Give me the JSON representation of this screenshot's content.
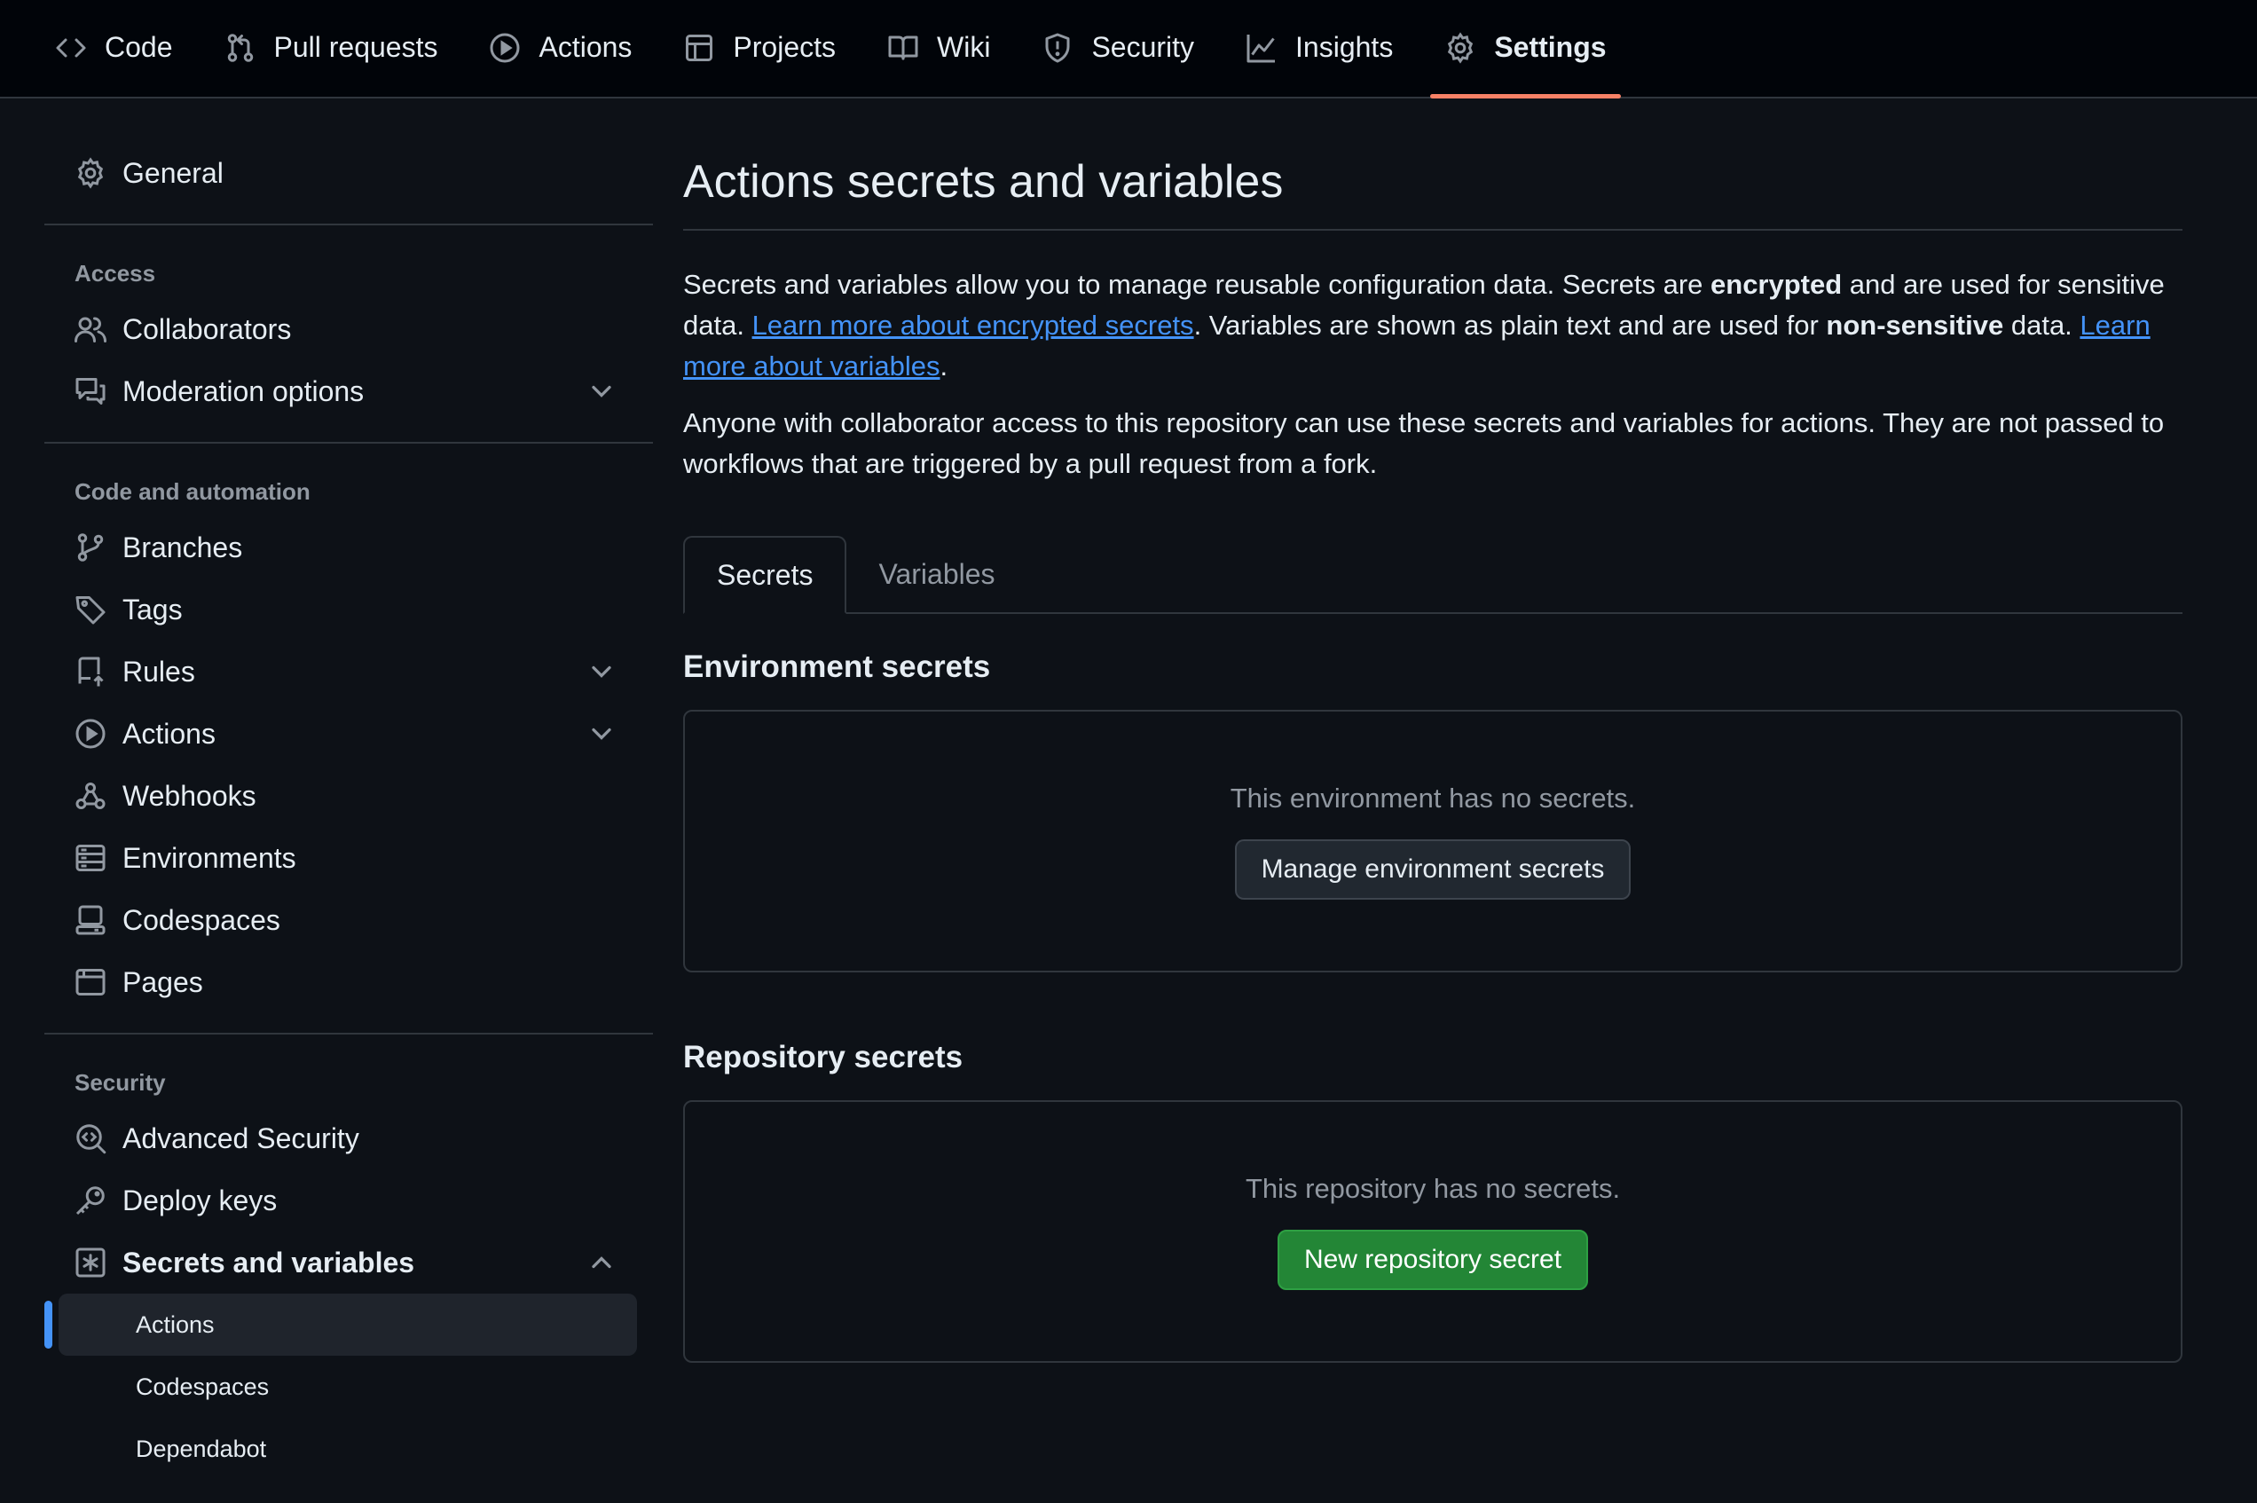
{
  "topnav": {
    "items": [
      {
        "label": "Code",
        "icon": "code-icon"
      },
      {
        "label": "Pull requests",
        "icon": "pull-request-icon"
      },
      {
        "label": "Actions",
        "icon": "play-icon"
      },
      {
        "label": "Projects",
        "icon": "table-icon"
      },
      {
        "label": "Wiki",
        "icon": "book-icon"
      },
      {
        "label": "Security",
        "icon": "shield-icon"
      },
      {
        "label": "Insights",
        "icon": "graph-icon"
      },
      {
        "label": "Settings",
        "icon": "gear-icon",
        "active": true
      }
    ]
  },
  "sidebar": {
    "general": "General",
    "access_heading": "Access",
    "collaborators": "Collaborators",
    "moderation": "Moderation options",
    "code_heading": "Code and automation",
    "branches": "Branches",
    "tags": "Tags",
    "rules": "Rules",
    "actions": "Actions",
    "webhooks": "Webhooks",
    "environments": "Environments",
    "codespaces": "Codespaces",
    "pages": "Pages",
    "security_heading": "Security",
    "advanced_security": "Advanced Security",
    "deploy_keys": "Deploy keys",
    "secrets_variables": "Secrets and variables",
    "sub_actions": "Actions",
    "sub_codespaces": "Codespaces",
    "sub_dependabot": "Dependabot"
  },
  "main": {
    "title": "Actions secrets and variables",
    "desc": {
      "p1": "Secrets and variables allow you to manage reusable configuration data. Secrets are ",
      "encrypted": "encrypted",
      "p2": " and are used for sensitive data. ",
      "link1": "Learn more about encrypted secrets",
      "p3": ". Variables are shown as plain text and are used for ",
      "non_sensitive": "non-sensitive",
      "p4": " data. ",
      "link2": "Learn more about variables",
      "p5": "."
    },
    "desc2": "Anyone with collaborator access to this repository can use these secrets and variables for actions. They are not passed to workflows that are triggered by a pull request from a fork.",
    "tabs": {
      "secrets": "Secrets",
      "variables": "Variables"
    },
    "env_title": "Environment secrets",
    "env_empty": "This environment has no secrets.",
    "env_button": "Manage environment secrets",
    "repo_title": "Repository secrets",
    "repo_empty": "This repository has no secrets.",
    "repo_button": "New repository secret"
  },
  "colors": {
    "accent": "#4493f8",
    "active_underline": "#f78166",
    "primary_button": "#238636"
  }
}
